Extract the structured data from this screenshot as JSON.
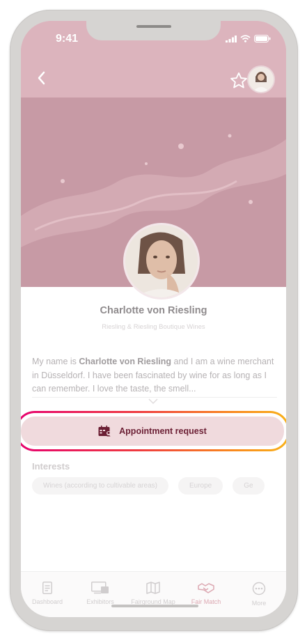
{
  "status": {
    "time": "9:41"
  },
  "profile": {
    "name": "Charlotte von Riesling",
    "company": "Riesling & Riesling Boutique Wines",
    "bio_prefix": "My name is ",
    "bio_name": "Charlotte von Riesling",
    "bio_rest": " and I am a wine merchant in Düsseldorf. I have been fascinated by wine for as long as I can remember. I love the taste, the smell..."
  },
  "actions": {
    "appointment_label": "Appointment request"
  },
  "interests": {
    "title": "Interests",
    "chips": [
      "Wines (according to cultivable areas)",
      "Europe",
      "Ge"
    ]
  },
  "tabs": [
    {
      "label": "Dashboard",
      "icon": "document-icon"
    },
    {
      "label": "Exhibitors",
      "icon": "exhibitor-booth-icon"
    },
    {
      "label": "Fairground Map",
      "icon": "map-icon"
    },
    {
      "label": "Fair Match",
      "icon": "handshake-icon",
      "active": true
    },
    {
      "label": "More",
      "icon": "more-dots-icon"
    }
  ],
  "colors": {
    "hero": "#d3a7b1",
    "accent_dark": "#6b1f34",
    "button_bg": "#f0dadd",
    "highlight_gradient_start": "#e6006f",
    "highlight_gradient_end": "#f9b21a"
  }
}
